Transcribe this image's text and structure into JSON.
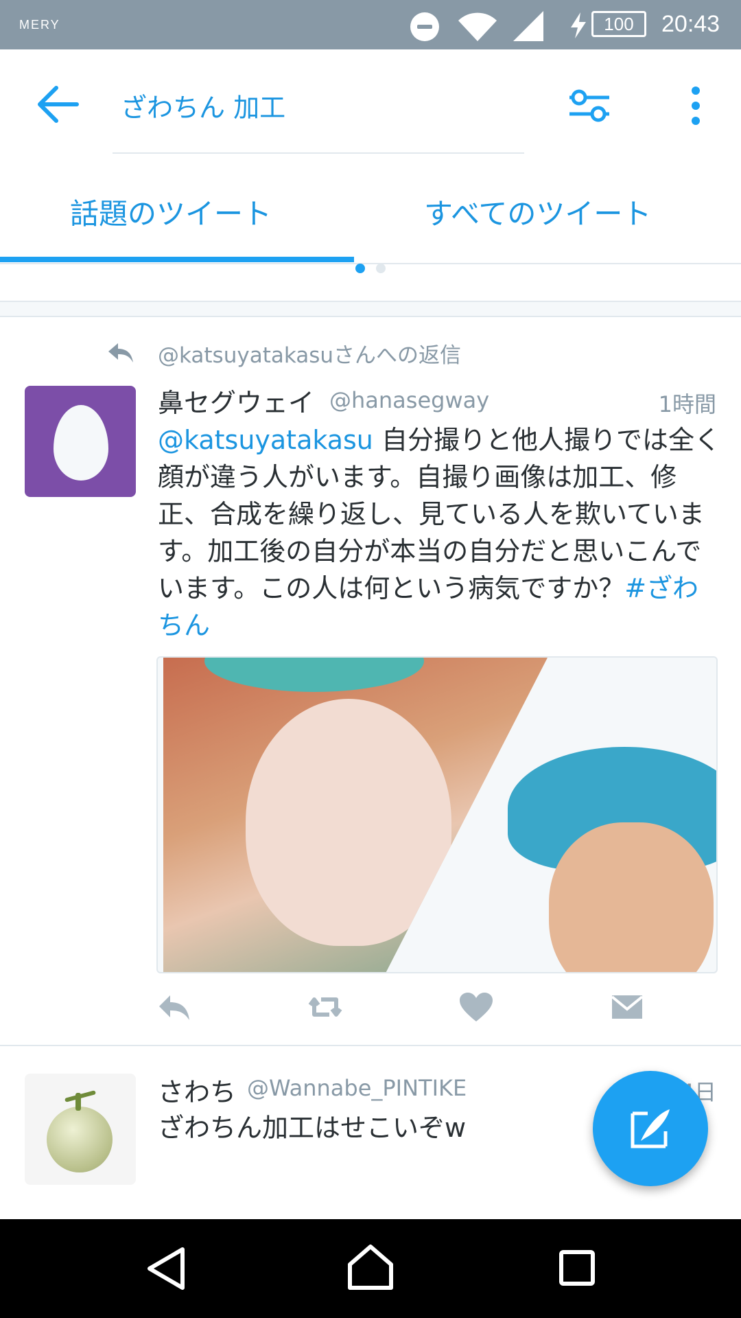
{
  "status_bar": {
    "carrier": "MERY",
    "battery": "100",
    "time": "20:43"
  },
  "app_bar": {
    "search_query": "ざわちん 加工"
  },
  "tabs": [
    {
      "label": "話題のツイート",
      "selected": true
    },
    {
      "label": "すべてのツイート",
      "selected": false
    }
  ],
  "tweets": [
    {
      "reply_context": "@katsuyatakasuさんへの返信",
      "name": "鼻セグウェイ",
      "handle": "@hanasegway",
      "time": "1時間",
      "mention": "@katsuyatakasu",
      "text": " 自分撮りと他人撮りでは全く顔が違う人がいます。自撮り画像は加工、修正、合成を繰り返し、見ている人を欺いています。加工後の自分が本当の自分だと思いこんでいます。この人は何という病気ですか？",
      "hashtag": "#ざわちん"
    },
    {
      "name": "さわち",
      "handle": "@Wannabe_PINTIKE",
      "time": "4日",
      "text": "ざわちん加工はせこいぞw"
    }
  ],
  "colors": {
    "accent": "#1da1f2",
    "link": "#1b95e0",
    "status_bar": "#8899a6",
    "egg_avatar": "#7c4ea8"
  }
}
